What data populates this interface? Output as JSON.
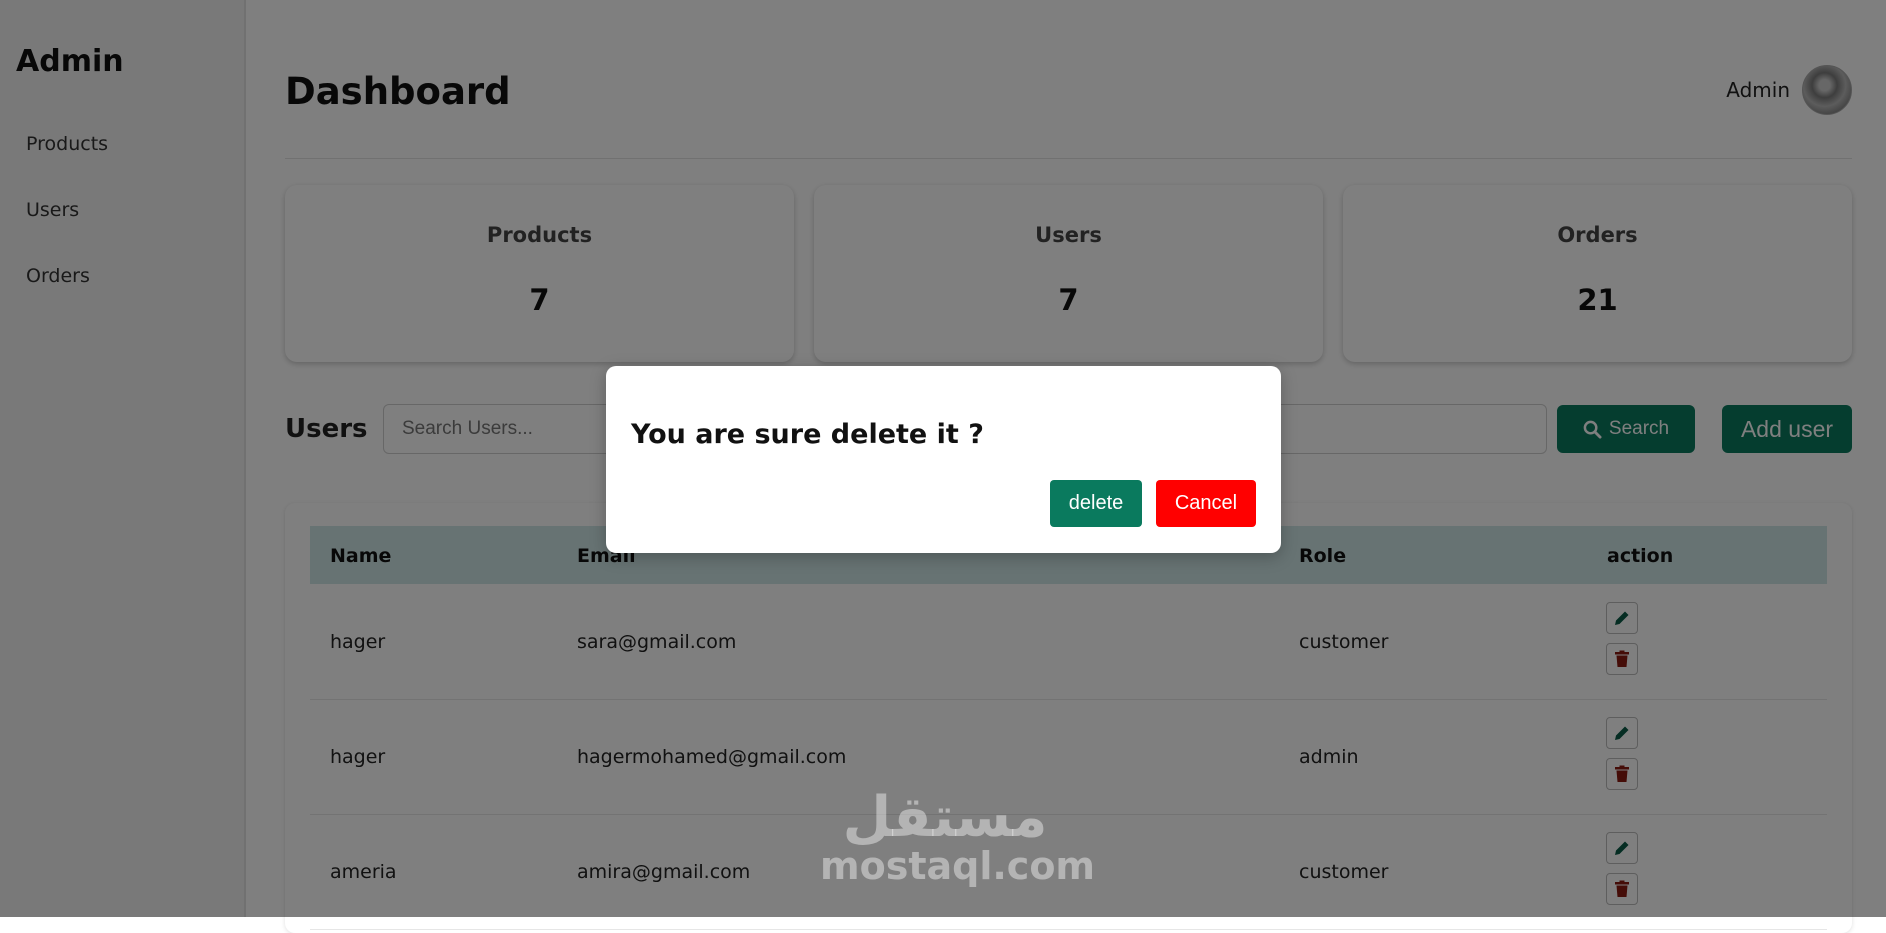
{
  "sidebar": {
    "brand": "Admin",
    "items": [
      {
        "label": "Products"
      },
      {
        "label": "Users"
      },
      {
        "label": "Orders"
      }
    ]
  },
  "header": {
    "title": "Dashboard",
    "user_name": "Admin"
  },
  "stats": [
    {
      "title": "Products",
      "value": "7"
    },
    {
      "title": "Users",
      "value": "7"
    },
    {
      "title": "Orders",
      "value": "21"
    }
  ],
  "users_section": {
    "heading": "Users",
    "search_placeholder": "Search Users...",
    "search_label": "Search",
    "add_label": "Add user"
  },
  "table": {
    "columns": [
      "Name",
      "Email",
      "Role",
      "action"
    ],
    "rows": [
      {
        "name": "hager",
        "email": "sara@gmail.com",
        "role": "customer"
      },
      {
        "name": "hager",
        "email": "hagermohamed@gmail.com",
        "role": "admin"
      },
      {
        "name": "ameria",
        "email": "amira@gmail.com",
        "role": "customer"
      }
    ]
  },
  "modal": {
    "message": "You are sure delete it ?",
    "delete_label": "delete",
    "cancel_label": "Cancel"
  },
  "watermark": {
    "arabic": "مستقل",
    "text": "mostaql.com"
  },
  "colors": {
    "primary": "#0a7a5e",
    "danger": "#ff0000",
    "table_header": "#cfe6e6",
    "delete_icon": "#8b1a10",
    "edit_icon": "#0a5a46"
  }
}
